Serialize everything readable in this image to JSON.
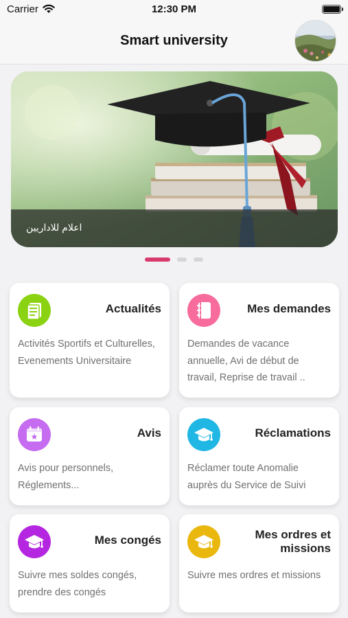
{
  "status_bar": {
    "carrier": "Carrier",
    "time": "12:30 PM"
  },
  "app_bar": {
    "title": "Smart university"
  },
  "banner": {
    "caption": "اعلام للاداريين",
    "slide_count": 3,
    "active_slide": 1
  },
  "colors": {
    "active_dot": "#d83a6e"
  },
  "cards": [
    {
      "title": "Actualités",
      "description": "Activités Sportifs et Culturelles, Evenements Universitaire",
      "icon": "news-icon",
      "icon_color": "#8bd212"
    },
    {
      "title": "Mes demandes",
      "description": "Demandes de vacance annuelle, Avi de début de travail, Reprise de travail ..",
      "icon": "notebook-icon",
      "icon_color": "#f76c9c"
    },
    {
      "title": "Avis",
      "description": "Avis pour personnels, Réglements...",
      "icon": "calendar-star-icon",
      "icon_color": "#c56cf0"
    },
    {
      "title": "Réclamations",
      "description": "Réclamer toute Anomalie auprès du Service de Suivi",
      "icon": "graduation-cap-icon",
      "icon_color": "#21b7e4"
    },
    {
      "title": "Mes congés",
      "description": "Suivre mes soldes congés, prendre des congés",
      "icon": "graduation-cap-icon",
      "icon_color": "#b526e0"
    },
    {
      "title": "Mes ordres et missions",
      "description": "Suivre mes ordres et missions",
      "icon": "graduation-cap-icon",
      "icon_color": "#e9b70e"
    }
  ]
}
